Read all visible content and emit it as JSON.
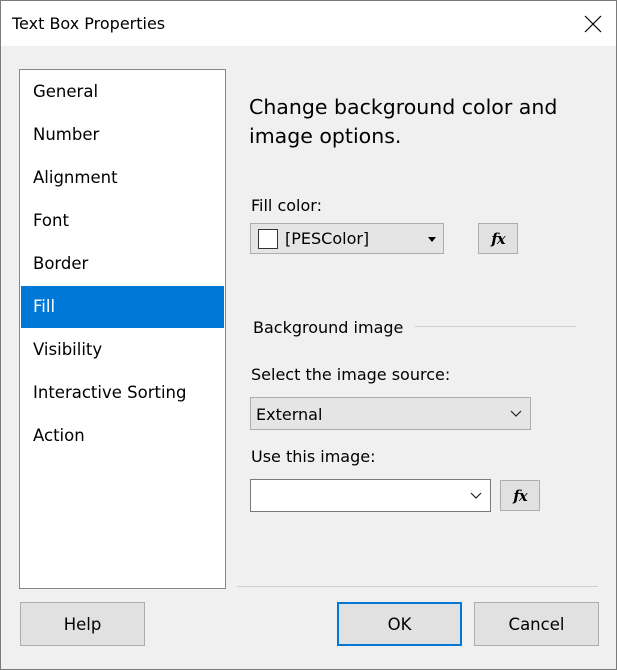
{
  "window": {
    "title": "Text Box Properties"
  },
  "nav": {
    "items": [
      {
        "label": "General"
      },
      {
        "label": "Number"
      },
      {
        "label": "Alignment"
      },
      {
        "label": "Font"
      },
      {
        "label": "Border"
      },
      {
        "label": "Fill"
      },
      {
        "label": "Visibility"
      },
      {
        "label": "Interactive Sorting"
      },
      {
        "label": "Action"
      }
    ],
    "selected": "Fill"
  },
  "fill_page": {
    "heading": "Change background color and image options.",
    "fill_color": {
      "label": "Fill color:",
      "value": "[PESColor]",
      "swatch_color": "#ffffff",
      "expression_button": "fx"
    },
    "background_image": {
      "section_label": "Background image",
      "source_label": "Select the image source:",
      "source_value": "External",
      "image_label": "Use this image:",
      "image_value": "",
      "expression_button": "fx"
    }
  },
  "footer": {
    "help_label": "Help",
    "ok_label": "OK",
    "cancel_label": "Cancel"
  },
  "colors": {
    "accent": "#0078d7",
    "dialog_background": "#f0f0f0",
    "combo_background": "#e5e5e5"
  }
}
